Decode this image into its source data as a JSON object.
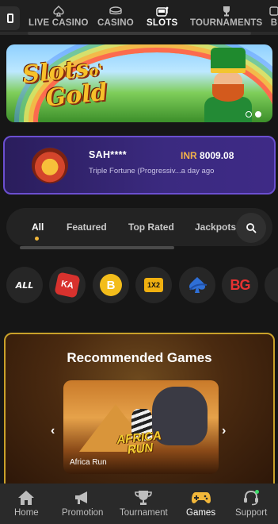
{
  "top_nav": {
    "items": [
      {
        "label": "LIVE CASINO",
        "icon": "spade-icon"
      },
      {
        "label": "CASINO",
        "icon": "chip-icon"
      },
      {
        "label": "SLOTS",
        "icon": "slot-machine-icon"
      },
      {
        "label": "TOURNAMENTS",
        "icon": "trophy-icon"
      },
      {
        "label": "B",
        "icon": "dice-icon"
      }
    ],
    "active": "SLOTS"
  },
  "banner": {
    "logo_line1": "Slots",
    "logo_line2": "Gold",
    "logo_connector": "o'",
    "slide_count": 2,
    "active_slide": 2
  },
  "winner": {
    "user": "SAH****",
    "currency": "INR",
    "amount": "8009.08",
    "game": "Triple Fortune (Progressiv...a day ago"
  },
  "filter_tabs": {
    "items": [
      "All",
      "Featured",
      "Top Rated",
      "Jackpots"
    ],
    "active": "All",
    "search_icon": "search-icon"
  },
  "providers": [
    {
      "name": "all-providers",
      "label": "ALL"
    },
    {
      "name": "provider-ka",
      "label": "KA"
    },
    {
      "name": "provider-b",
      "label": "B"
    },
    {
      "name": "provider-1x2",
      "label": "1X2"
    },
    {
      "name": "provider-spade",
      "label": ""
    },
    {
      "name": "provider-bg",
      "label": "BG"
    }
  ],
  "recommended": {
    "title": "Recommended Games",
    "game_name": "Africa Run",
    "game_logo_line1": "AFRICA",
    "game_logo_line2": "RUN",
    "prev_icon": "‹",
    "next_icon": "›"
  },
  "bottom_nav": {
    "items": [
      {
        "label": "Home",
        "icon": "home-icon"
      },
      {
        "label": "Promotion",
        "icon": "megaphone-icon"
      },
      {
        "label": "Tournament",
        "icon": "trophy-icon"
      },
      {
        "label": "Games",
        "icon": "gamepad-icon"
      },
      {
        "label": "Support",
        "icon": "headset-icon"
      }
    ],
    "active": "Games"
  },
  "colors": {
    "background": "#161616",
    "accent_gold": "#f2b73a",
    "winner_card": "#3b2a80",
    "winner_border": "#6b4fd0",
    "currency": "#f2b04a"
  }
}
